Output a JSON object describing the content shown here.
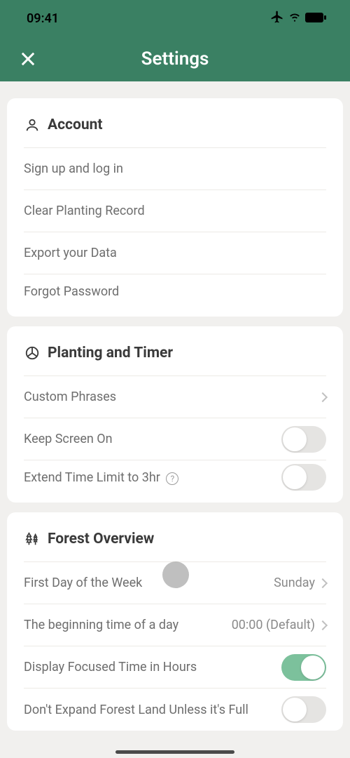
{
  "statusBar": {
    "time": "09:41"
  },
  "header": {
    "title": "Settings"
  },
  "sections": {
    "account": {
      "title": "Account",
      "items": {
        "signup": "Sign up and log in",
        "clear": "Clear Planting Record",
        "export": "Export your Data",
        "forgot": "Forgot Password"
      }
    },
    "planting": {
      "title": "Planting and Timer",
      "items": {
        "phrases": "Custom Phrases",
        "screenOn": "Keep Screen On",
        "extend": "Extend Time Limit to 3hr"
      },
      "toggles": {
        "screenOn": false,
        "extend": false
      }
    },
    "forest": {
      "title": "Forest Overview",
      "items": {
        "firstDay": {
          "label": "First Day of the Week",
          "value": "Sunday"
        },
        "beginTime": {
          "label": "The beginning time of a day",
          "value": "00:00 (Default)"
        },
        "displayHours": "Display Focused Time in Hours",
        "dontExpand": "Don't Expand Forest Land Unless it's Full"
      },
      "toggles": {
        "displayHours": true,
        "dontExpand": false
      }
    }
  }
}
